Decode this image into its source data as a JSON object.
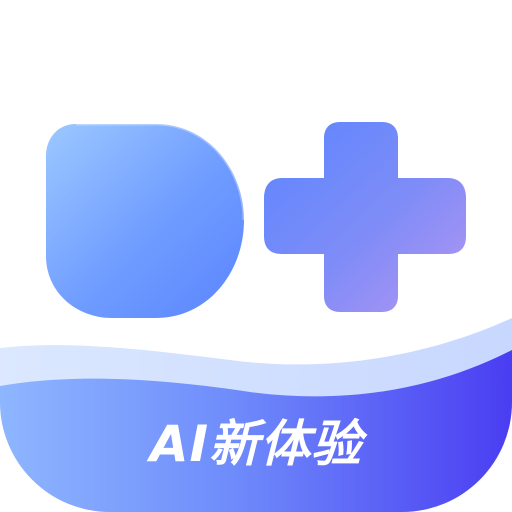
{
  "banner": {
    "text": "AI新体验"
  },
  "colors": {
    "tile_background": "#ffffff",
    "glyph_light_blue": "#8fc0ff",
    "glyph_mid_blue": "#5b86ff",
    "plus_purple": "#a98bf5",
    "wave_deep_blue": "#4a3df2",
    "wave_light_blue": "#7aa6ff",
    "banner_text": "#ffffff"
  },
  "icons": {
    "letter_shape": "d-letter-icon",
    "plus_shape": "plus-icon"
  }
}
